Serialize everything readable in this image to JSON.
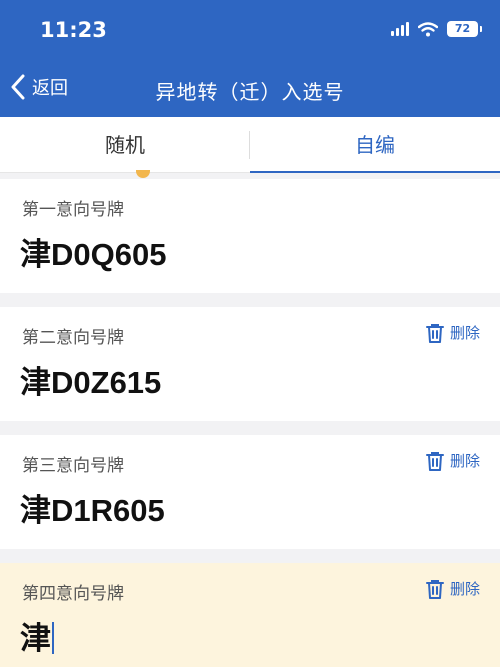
{
  "status_bar": {
    "time": "11:23",
    "battery": "72"
  },
  "nav": {
    "back_label": "返回",
    "title": "异地转（迁）入选号"
  },
  "tabs": [
    {
      "label": "随机",
      "active": false
    },
    {
      "label": "自编",
      "active": true
    }
  ],
  "cards": [
    {
      "label": "第一意向号牌",
      "plate": "津D0Q605"
    },
    {
      "label": "第二意向号牌",
      "plate": "津D0Z615",
      "delete_label": "删除"
    },
    {
      "label": "第三意向号牌",
      "plate": "津D1R605",
      "delete_label": "删除"
    },
    {
      "label": "第四意向号牌",
      "plate": "津",
      "delete_label": "删除"
    }
  ],
  "colors": {
    "accent": "#2e66c2",
    "highlight": "#fdf4dd",
    "background": "#f2f2f4"
  }
}
